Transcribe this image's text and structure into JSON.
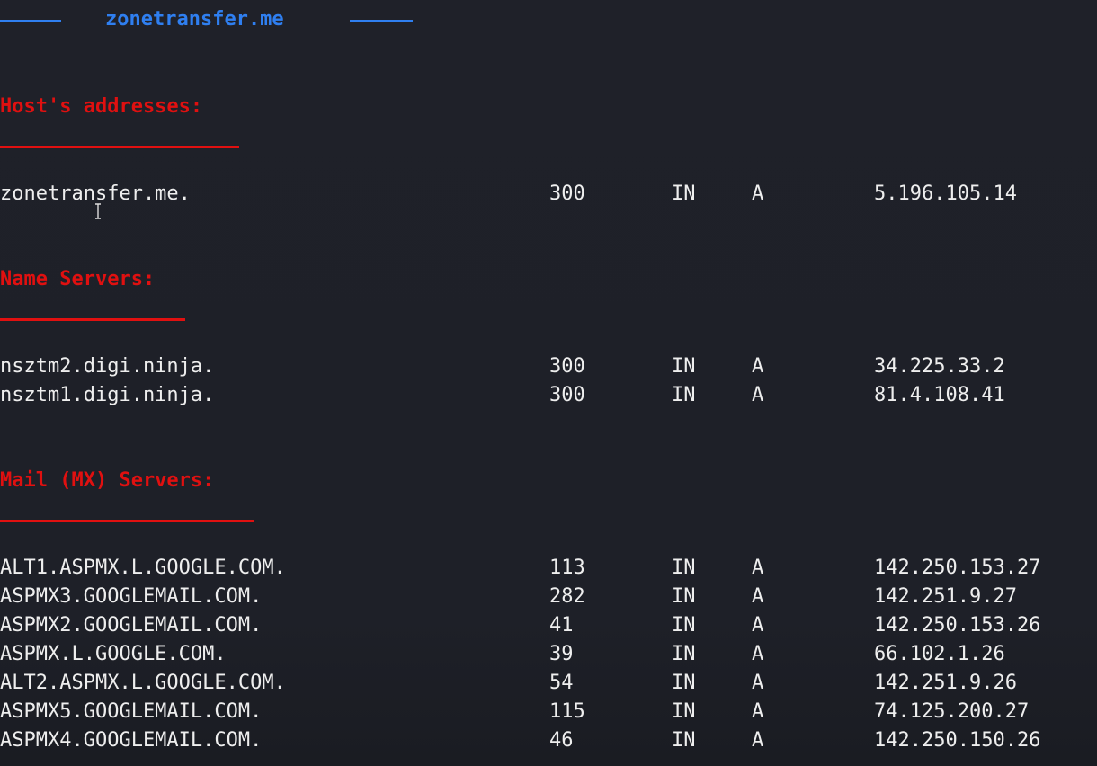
{
  "banner": {
    "title": "zonetransfer.me",
    "accent_color": "#2f7ff0"
  },
  "section_color": "#e01010",
  "sections": [
    {
      "header": "Host's addresses:",
      "records": [
        {
          "name": "zonetransfer.me.",
          "ttl": "300",
          "class": "IN",
          "type": "A",
          "address": "5.196.105.14"
        }
      ]
    },
    {
      "header": "Name Servers:",
      "records": [
        {
          "name": "nsztm2.digi.ninja.",
          "ttl": "300",
          "class": "IN",
          "type": "A",
          "address": "34.225.33.2"
        },
        {
          "name": "nsztm1.digi.ninja.",
          "ttl": "300",
          "class": "IN",
          "type": "A",
          "address": "81.4.108.41"
        }
      ]
    },
    {
      "header": "Mail (MX) Servers:",
      "records": [
        {
          "name": "ALT1.ASPMX.L.GOOGLE.COM.",
          "ttl": "113",
          "class": "IN",
          "type": "A",
          "address": "142.250.153.27"
        },
        {
          "name": "ASPMX3.GOOGLEMAIL.COM.",
          "ttl": "282",
          "class": "IN",
          "type": "A",
          "address": "142.251.9.27"
        },
        {
          "name": "ASPMX2.GOOGLEMAIL.COM.",
          "ttl": "41",
          "class": "IN",
          "type": "A",
          "address": "142.250.153.26"
        },
        {
          "name": "ASPMX.L.GOOGLE.COM.",
          "ttl": "39",
          "class": "IN",
          "type": "A",
          "address": "66.102.1.26"
        },
        {
          "name": "ALT2.ASPMX.L.GOOGLE.COM.",
          "ttl": "54",
          "class": "IN",
          "type": "A",
          "address": "142.251.9.26"
        },
        {
          "name": "ASPMX5.GOOGLEMAIL.COM.",
          "ttl": "115",
          "class": "IN",
          "type": "A",
          "address": "74.125.200.27"
        },
        {
          "name": "ASPMX4.GOOGLEMAIL.COM.",
          "ttl": "46",
          "class": "IN",
          "type": "A",
          "address": "142.250.150.26"
        }
      ]
    }
  ],
  "cursor": {
    "icon": "text-cursor-icon"
  }
}
